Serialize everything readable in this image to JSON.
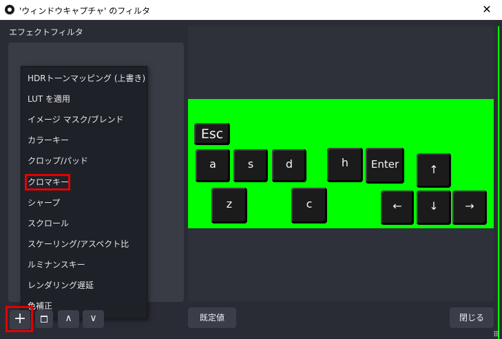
{
  "window": {
    "title": "'ウィンドウキャプチャ' のフィルタ",
    "close_glyph": "✕",
    "app_icon": "obs-logo-icon"
  },
  "left_panel": {
    "label": "エフェクトフィルタ"
  },
  "dropdown": {
    "items": [
      "HDRトーンマッピング (上書き)",
      "LUT を適用",
      "イメージ マスク/ブレンド",
      "カラーキー",
      "クロップ/パッド",
      "クロマキー",
      "シャープ",
      "スクロール",
      "スケーリング/アスペクト比",
      "ルミナンスキー",
      "レンダリング遅延",
      "色補正"
    ],
    "highlighted": "クロマキー"
  },
  "bottom_buttons": {
    "add": "+",
    "remove": "trash-icon",
    "up": "∧",
    "down": "∨"
  },
  "preview": {
    "keys": {
      "esc": "Esc",
      "a": "a",
      "s": "s",
      "d": "d",
      "h": "h",
      "enter": "Enter",
      "up": "↑",
      "z": "z",
      "c": "c",
      "left": "←",
      "down": "↓",
      "right": "→"
    }
  },
  "footer": {
    "defaults": "既定値",
    "close": "閉じる"
  },
  "colors": {
    "background": "#2a2c35",
    "list_bg": "#393b45",
    "chroma_green": "#00ff00",
    "highlight_red": "#e60000"
  }
}
